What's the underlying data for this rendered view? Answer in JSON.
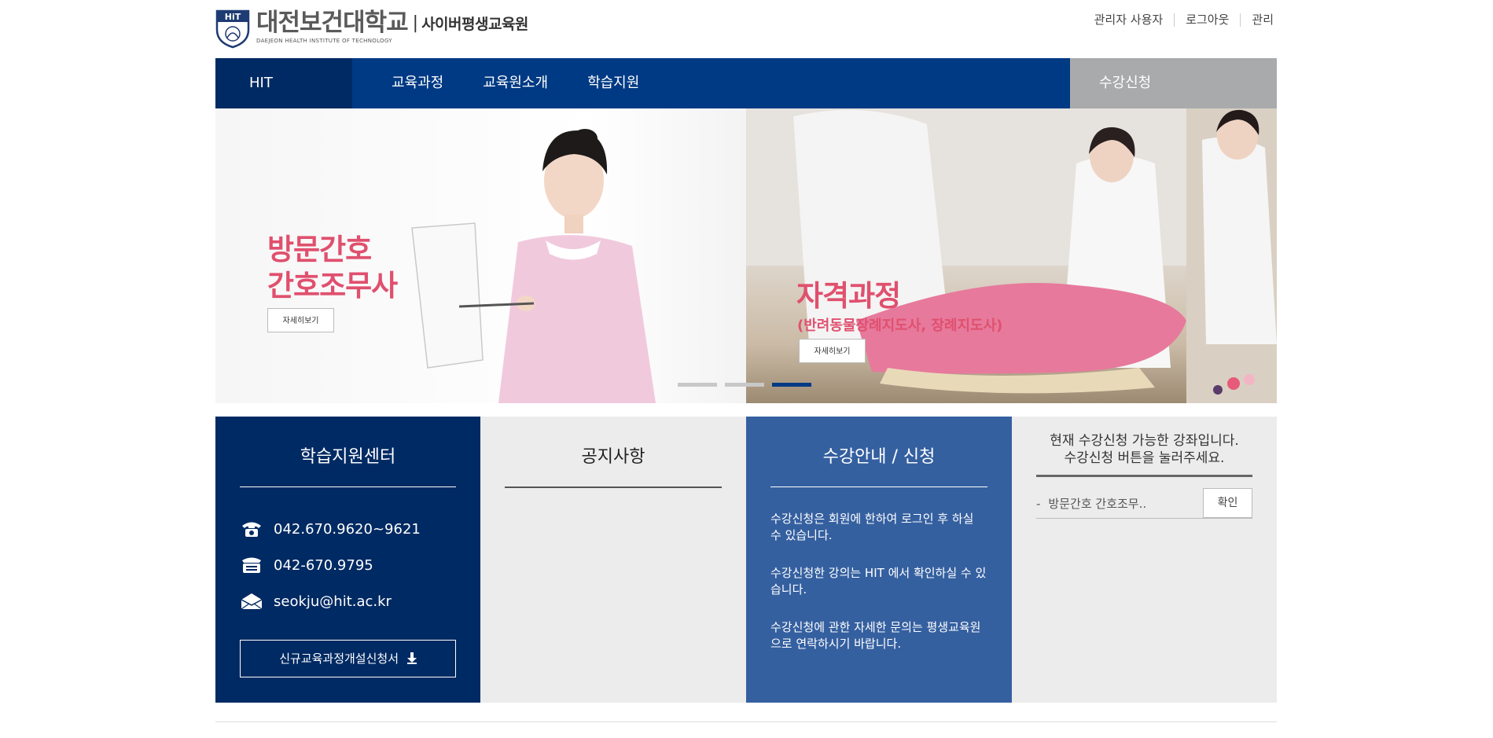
{
  "header": {
    "logo_main": "대전보건대학교",
    "logo_sep": "|",
    "logo_sub": "사이버평생교육원",
    "logo_en": "DAEJEON HEALTH INSTITUTE OF TECHNOLOGY",
    "emblem_text": "HiT",
    "util_links": [
      "관리자 사용자",
      "로그아웃",
      "관리"
    ]
  },
  "nav": {
    "home": "HIT",
    "items": [
      "교육과정",
      "교육원소개",
      "학습지원"
    ],
    "apply": "수강신청",
    "colors": {
      "primary": "#003a84",
      "dark": "#002a63",
      "apply_bg": "#a9aaac"
    }
  },
  "banner": {
    "slide1_title_line1": "방문간호",
    "slide1_title_line2": "간호조무사",
    "slide1_button": "자세히보기",
    "slide2_title": "자격과정",
    "slide2_subtitle": "(반려동물장례지도사, 장례지도사)",
    "slide2_button": "자세히보기",
    "active_dot": 3,
    "title_color": "#e0506e"
  },
  "support": {
    "title": "학습지원센터",
    "phone": "042.670.9620~9621",
    "fax": "042-670.9795",
    "email": "seokju@hit.ac.kr",
    "download_button": "신규교육과정개설신청서",
    "icons": [
      "phone-icon",
      "fax-icon",
      "mail-icon",
      "download-icon"
    ]
  },
  "notice": {
    "title": "공지사항"
  },
  "guide": {
    "title": "수강안내 / 신청",
    "paragraphs": [
      "수강신청은 회원에 한하여 로그인 후 하실 수 있습니다.",
      "수강신청한 강의는 HIT 에서 확인하실 수 있습니다.",
      "수강신청에 관한 자세한 문의는 평생교육원으로 연락하시기 바랍니다."
    ]
  },
  "courses": {
    "head_line1": "현재 수강신청 가능한 강좌입니다.",
    "head_line2": "수강신청 버튼을 눌러주세요.",
    "items": [
      {
        "dash": "-",
        "name": "방문간호 간호조무..",
        "button": "확인"
      }
    ]
  }
}
